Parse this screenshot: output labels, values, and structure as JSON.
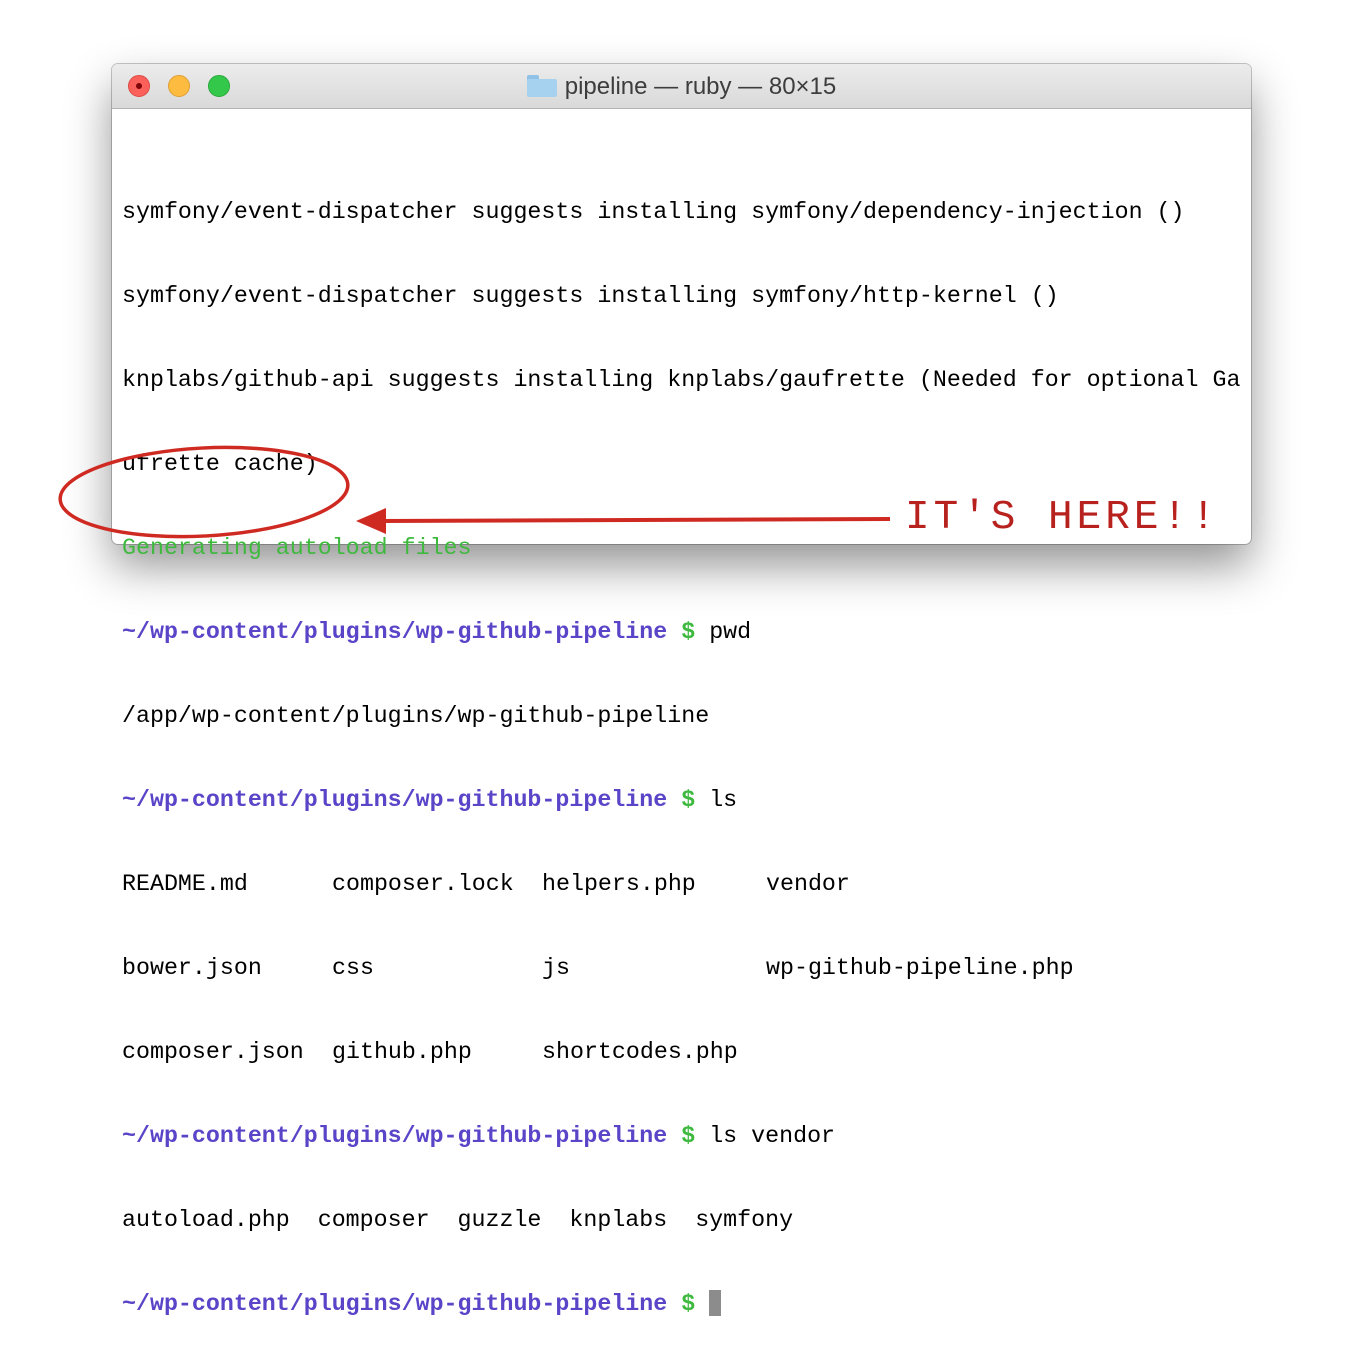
{
  "window": {
    "title": "pipeline — ruby — 80×15",
    "title_icon": "folder-icon",
    "buttons": [
      "close",
      "minimize",
      "zoom"
    ]
  },
  "terminal": {
    "lines": {
      "l1": "symfony/event-dispatcher suggests installing symfony/dependency-injection ()",
      "l2": "symfony/event-dispatcher suggests installing symfony/http-kernel ()",
      "l3": "knplabs/github-api suggests installing knplabs/gaufrette (Needed for optional Ga",
      "l4": "ufrette cache)",
      "l5": "Generating autoload files",
      "l7": "/app/wp-content/plugins/wp-github-pipeline",
      "l13": "autoload.php  composer  guzzle  knplabs  symfony"
    },
    "prompt_path": "~/wp-content/plugins/wp-github-pipeline",
    "prompt_symbol": "$",
    "commands": {
      "c1": "pwd",
      "c2": "ls",
      "c3": "ls vendor"
    },
    "ls_output": {
      "r1": [
        "README.md",
        "composer.lock",
        "helpers.php",
        "vendor"
      ],
      "r2": [
        "bower.json",
        "css",
        "js",
        "wp-github-pipeline.php"
      ],
      "r3": [
        "composer.json",
        "github.php",
        "shortcodes.php",
        ""
      ]
    }
  },
  "annotation": {
    "text": "IT'S HERE!!",
    "color": "#b8221e"
  },
  "colors": {
    "prompt_path": "#5a44c8",
    "prompt_symbol": "#3eb93e",
    "success_text": "#3eb93e"
  }
}
